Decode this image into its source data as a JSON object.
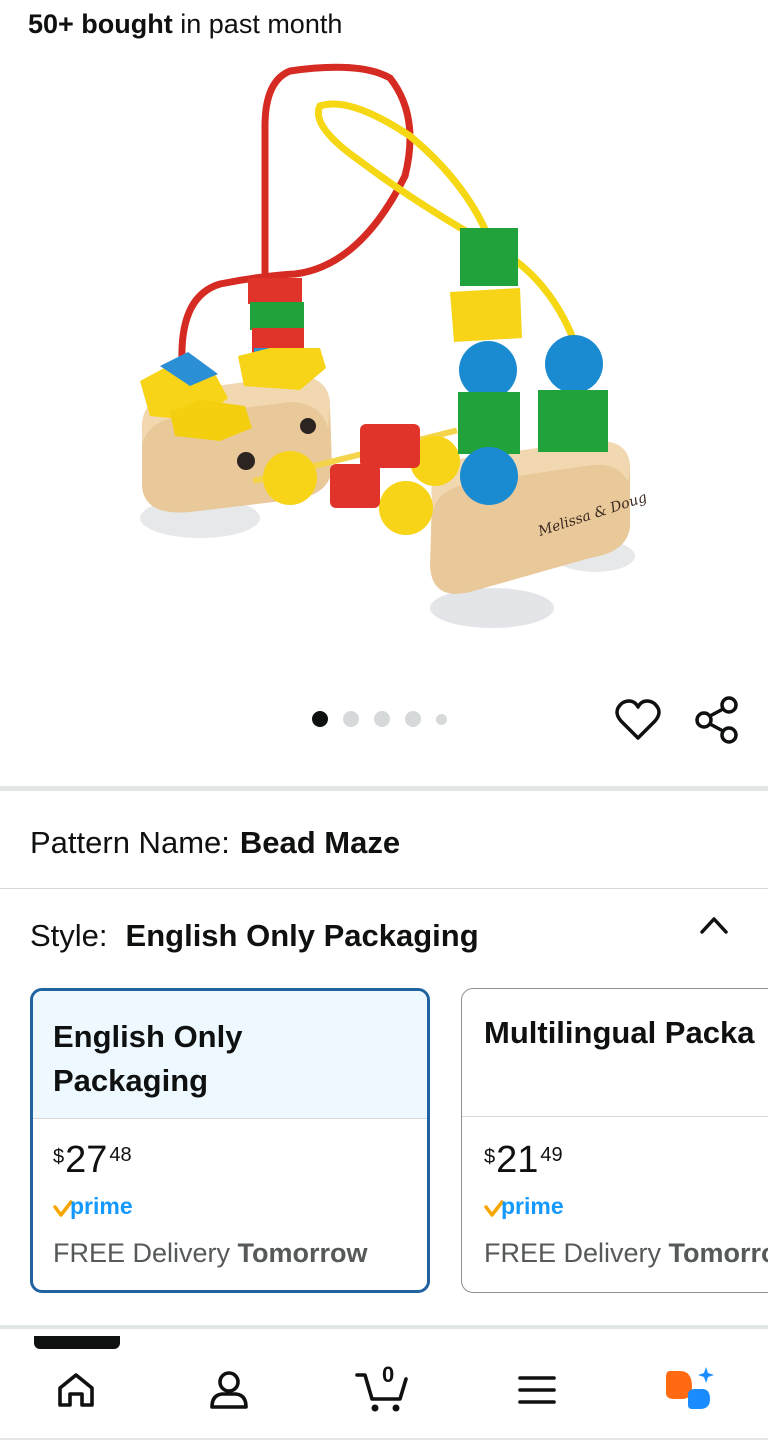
{
  "header": {
    "bought_bold": "50+ bought",
    "bought_rest": " in past month"
  },
  "gallery": {
    "image_label": "Melissa & Doug",
    "dot_count": 5,
    "active_index": 0
  },
  "actions": {
    "wishlist_icon": "heart-icon",
    "share_icon": "share-icon"
  },
  "pattern": {
    "label": "Pattern Name:",
    "value": "Bead Maze"
  },
  "style": {
    "label": "Style:",
    "value": "English Only Packaging",
    "options": [
      {
        "name_line1": "English Only",
        "name_line2": "Packaging",
        "price_symbol": "$",
        "price_whole": "27",
        "price_fraction": "48",
        "prime": "prime",
        "delivery_text": "FREE Delivery ",
        "delivery_day": "Tomorrow",
        "selected": true
      },
      {
        "name_line1": "Multilingual Packa",
        "price_symbol": "$",
        "price_whole": "21",
        "price_fraction": "49",
        "prime": "prime",
        "delivery_text": "FREE Delivery ",
        "delivery_day": "Tomorro",
        "selected": false
      }
    ]
  },
  "bottom_nav": {
    "items": [
      "home-icon",
      "account-icon",
      "cart-icon",
      "menu-icon",
      "rufus-icon"
    ],
    "cart_count": "0"
  },
  "colors": {
    "accent_blue": "#2162a1",
    "selected_bg": "#edf8ff",
    "prime_blue": "#1399ff",
    "prime_orange": "#f7a600"
  }
}
